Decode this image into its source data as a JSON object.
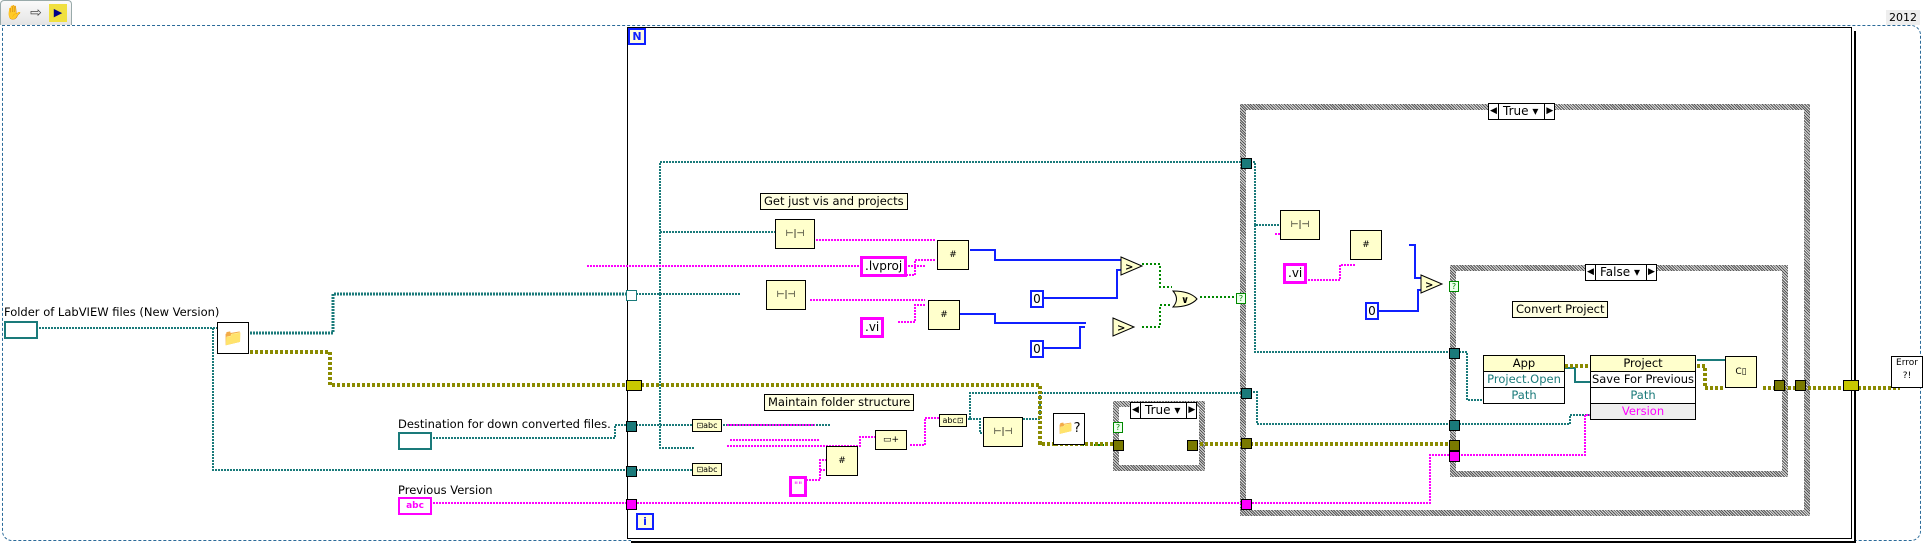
{
  "toolbar": {
    "icons": [
      "hand-tool-icon",
      "run-arrow-icon",
      "vi-snippet-icon"
    ],
    "glyphs": [
      "✋",
      "⇨",
      "▶"
    ]
  },
  "version_badge": "2012",
  "loop": {
    "count_label": "N",
    "iteration_label": "i"
  },
  "controls": {
    "folder": "Folder of LabVIEW files (New Version)",
    "destination": "Destination for down converted files.",
    "previous_version": "Previous Version",
    "previous_version_glyph": "abc"
  },
  "comments": {
    "get_vis": "Get just vis and projects",
    "maintain_folder": "Maintain folder structure",
    "convert_project": "Convert Project"
  },
  "constants": {
    "lvproj": ".lvproj",
    "vi_a": ".vi",
    "vi_b": ".vi",
    "zero_a": "0",
    "zero_b": "0",
    "zero_c": "0",
    "empty_string": "\"\""
  },
  "cases": {
    "outer_selector": "True",
    "small_selector": "True",
    "inner_selector": "False"
  },
  "property_nodes": {
    "app": {
      "class": "App",
      "rows": [
        "Project.Open",
        "Path"
      ]
    },
    "project": {
      "class": "Project",
      "rows": [
        "Save For Previous",
        "Path",
        "Version"
      ]
    }
  },
  "nodes": {
    "or_gate": "∨",
    "gt": ">",
    "error_handler": "Error ?!",
    "path_to_str": "⊡abc",
    "str_to_path": "abc⊡"
  },
  "colors": {
    "path_wire": "#1a7a7a",
    "string_wire": "#ff00ff",
    "numeric_wire": "#1020ff",
    "bool_wire": "#008800",
    "error_wire": "#b0b000",
    "outer_border": "#2a6a99"
  }
}
